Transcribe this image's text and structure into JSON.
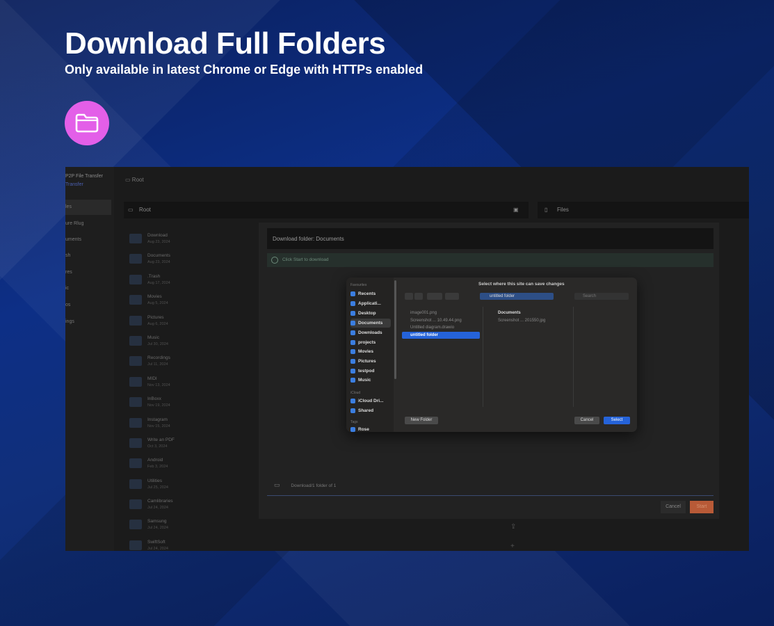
{
  "hero": {
    "title": "Download Full Folders",
    "subtitle": "Only available in latest Chrome or Edge with HTTPs enabled",
    "icon": "folder-icon",
    "icon_bg": "#e35fe8"
  },
  "app": {
    "sidebar": {
      "app_name": "P2P File Transfer",
      "app_subtitle": "Transfer",
      "items": [
        "les",
        "ure Rlug",
        "uments",
        "sh",
        "res",
        "ic",
        "os",
        "ings"
      ]
    },
    "topbar_label": "Root",
    "root_bar_label": "Root",
    "files_bar_label": "Files",
    "folders": [
      {
        "name": "Download",
        "date": "Aug 23, 2024"
      },
      {
        "name": "Documents",
        "date": "Aug 23, 2024"
      },
      {
        "name": ".Trash",
        "date": "Aug 17, 2024"
      },
      {
        "name": "Movies",
        "date": "Aug 5, 2024"
      },
      {
        "name": "Pictures",
        "date": "Aug 6, 2024"
      },
      {
        "name": "Music",
        "date": "Jul 30, 2024"
      },
      {
        "name": "Recordings",
        "date": "Jul 11, 2024"
      },
      {
        "name": "MIDI",
        "date": "Nov 13, 2024"
      },
      {
        "name": "InBoxx",
        "date": "Nov 19, 2024"
      },
      {
        "name": "Instagram",
        "date": "Nov 15, 2024"
      },
      {
        "name": "Write an PDF",
        "date": "Oct 3, 2024"
      },
      {
        "name": "Android",
        "date": "Feb 3, 2024"
      },
      {
        "name": "Utilities",
        "date": "Jul 25, 2024"
      },
      {
        "name": "Camlibraries",
        "date": "Jul 24, 2024"
      },
      {
        "name": "Samsung",
        "date": "Jul 24, 2024"
      },
      {
        "name": "SwiftSoft",
        "date": "Jul 24, 2024"
      }
    ],
    "download": {
      "header": "Download folder: Documents",
      "info": "Click Start to download",
      "target_folder": "Download/1 folder of 1",
      "cancel_label": "Cancel",
      "start_label": "Start"
    },
    "dialog": {
      "title": "Select where this site can save changes",
      "location": "untitled folder",
      "search_placeholder": "Search",
      "favorites_label": "Favourites",
      "favorites": [
        "Recents",
        "Applicati...",
        "Desktop",
        "Documents",
        "Downloads",
        "projects",
        "Movies",
        "Pictures",
        "testpod",
        "Music"
      ],
      "icloud_label": "iCloud",
      "icloud": [
        "iCloud Dri...",
        "Shared"
      ],
      "tags_label": "Tags",
      "tags": [
        "Rose"
      ],
      "column1": [
        "image001.png",
        "Screenshot ... 10.49.44.png",
        "Untitled diagram.drawio",
        "untitled folder"
      ],
      "column2": [
        "Documents",
        "Screenshot ... 201550.jpg"
      ],
      "new_folder_label": "New Folder",
      "cancel_label": "Cancel",
      "select_label": "Select"
    }
  }
}
